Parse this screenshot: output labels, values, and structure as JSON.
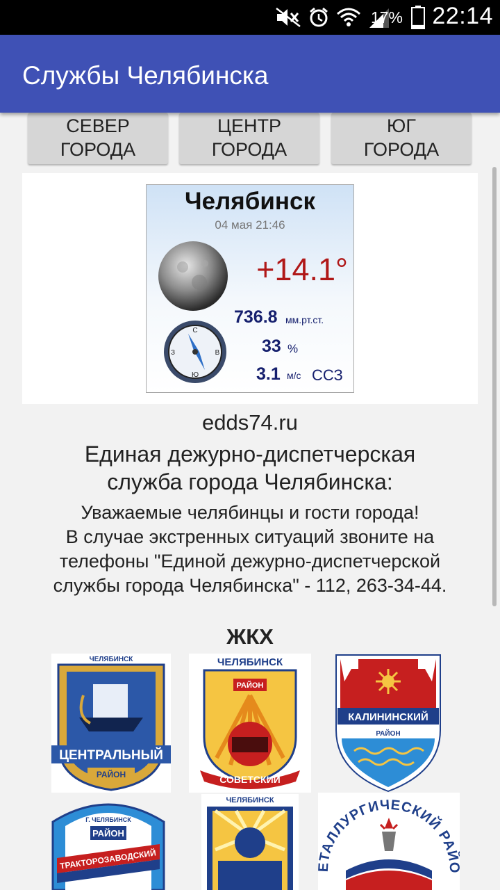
{
  "status_bar": {
    "time": "22:14",
    "battery_percent": "17%",
    "battery_level": 0.17,
    "icons": [
      "mute-icon",
      "alarm-icon",
      "wifi-icon",
      "signal-icon",
      "battery-icon"
    ]
  },
  "app_bar": {
    "title": "Службы Челябинска",
    "color": "#3f51b5"
  },
  "tabs": [
    {
      "line1": "СЕВЕР",
      "line2": "ГОРОДА"
    },
    {
      "line1": "ЦЕНТР",
      "line2": "ГОРОДА"
    },
    {
      "line1": "ЮГ",
      "line2": "ГОРОДА"
    }
  ],
  "weather": {
    "city": "Челябинск",
    "date": "04 мая 21:46",
    "temperature": "+14.1°",
    "pressure": "736.8",
    "pressure_unit": "мм.рт.ст.",
    "humidity": "33",
    "humidity_unit": "%",
    "wind_speed": "3.1",
    "wind_unit": "м/с",
    "wind_direction": "ССЗ",
    "compass": {
      "n": "С",
      "s": "Ю",
      "e": "В",
      "w": "З"
    }
  },
  "info": {
    "site": "edds74.ru",
    "heading_line1": "Единая дежурно-диспетчерская",
    "heading_line2": "служба города Челябинска:",
    "notice_line1": "Уважаемые челябинцы и гости города!",
    "notice_line2": "В случае экстренных ситуаций звоните на",
    "notice_line3": "телефоны \"Единой дежурно-диспетчерской",
    "notice_line4": "службы города Челябинска\" - 112, 263-34-44."
  },
  "section": {
    "title": "ЖКХ"
  },
  "emblems": [
    {
      "name": "central",
      "top_text": "ЧЕЛЯБИНСК",
      "label": "ЦЕНТРАЛЬНЫЙ",
      "sub": "РАЙОН"
    },
    {
      "name": "sovetsky",
      "top_text": "ЧЕЛЯБИНСК",
      "banner": "РАЙОН",
      "label": "СОВЕТСКИЙ"
    },
    {
      "name": "kalininsky",
      "label": "КАЛИНИНСКИЙ",
      "sub": "РАЙОН"
    },
    {
      "name": "traktorozavodsky",
      "top_text": "Г. ЧЕЛЯБИНСК",
      "banner": "РАЙОН",
      "label": "ТРАКТОРОЗАВОДСКИЙ"
    },
    {
      "name": "kurchatovsky",
      "top_text": "ЧЕЛЯБИНСК"
    },
    {
      "name": "metallurgichesky",
      "label": "МЕТАЛЛУРГИЧЕСКИЙ РАЙОН"
    }
  ]
}
